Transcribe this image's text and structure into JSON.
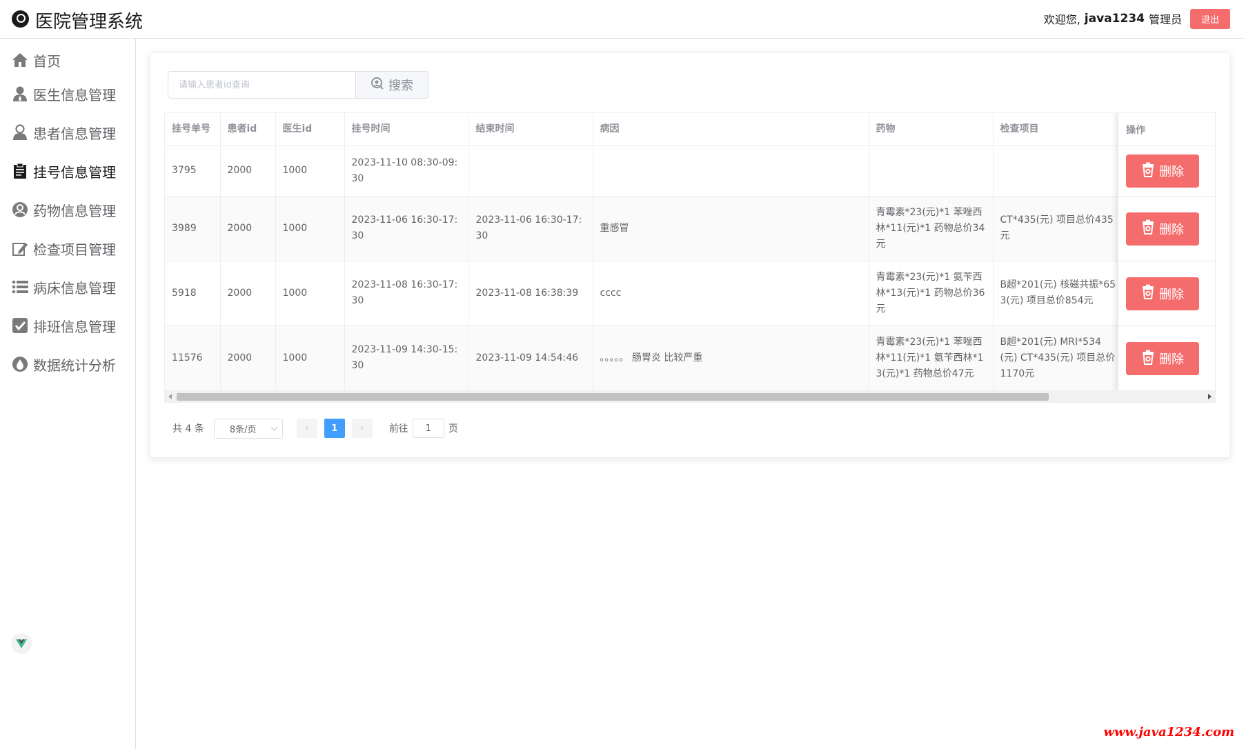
{
  "header": {
    "title": "医院管理系统",
    "welcome": "欢迎您,",
    "username": "java1234",
    "role": "管理员",
    "logout_label": "退出",
    "logo_icon": "hospital-logo-icon"
  },
  "sidebar": {
    "items": [
      {
        "label": "首页",
        "icon": "home-icon",
        "active": false
      },
      {
        "label": "医生信息管理",
        "icon": "doctor-icon",
        "active": false
      },
      {
        "label": "患者信息管理",
        "icon": "patient-icon",
        "active": false
      },
      {
        "label": "挂号信息管理",
        "icon": "clipboard-icon",
        "active": true
      },
      {
        "label": "药物信息管理",
        "icon": "medicine-icon",
        "active": false
      },
      {
        "label": "检查项目管理",
        "icon": "edit-icon",
        "active": false
      },
      {
        "label": "病床信息管理",
        "icon": "list-icon",
        "active": false
      },
      {
        "label": "排班信息管理",
        "icon": "checkbox-icon",
        "active": false
      },
      {
        "label": "数据统计分析",
        "icon": "chart-icon",
        "active": false
      }
    ],
    "footer_icon": "vue-icon"
  },
  "search": {
    "placeholder": "请输入患者id查询",
    "value": "",
    "button_label": "搜索"
  },
  "table": {
    "columns": [
      "挂号单号",
      "患者id",
      "医生id",
      "挂号时间",
      "结束时间",
      "病因",
      "药物",
      "检查项目",
      "操作"
    ],
    "rows": [
      {
        "id": "3795",
        "patient_id": "2000",
        "doctor_id": "1000",
        "reg_time": "2023-11-10 08:30-09:30",
        "end_time": "",
        "cause": "",
        "medicine": "",
        "exam": ""
      },
      {
        "id": "3989",
        "patient_id": "2000",
        "doctor_id": "1000",
        "reg_time": "2023-11-06 16:30-17:30",
        "end_time": "2023-11-06 16:30-17:30",
        "cause": "重感冒",
        "medicine": "青霉素*23(元)*1 苯唑西林*11(元)*1 药物总价34元",
        "exam": "CT*435(元) 项目总价435元"
      },
      {
        "id": "5918",
        "patient_id": "2000",
        "doctor_id": "1000",
        "reg_time": "2023-11-08 16:30-17:30",
        "end_time": "2023-11-08 16:38:39",
        "cause": "cccc",
        "medicine": "青霉素*23(元)*1 氨苄西林*13(元)*1 药物总价36元",
        "exam": "B超*201(元) 核磁共振*653(元) 项目总价854元"
      },
      {
        "id": "11576",
        "patient_id": "2000",
        "doctor_id": "1000",
        "reg_time": "2023-11-09 14:30-15:30",
        "end_time": "2023-11-09 14:54:46",
        "cause": "。。。。。 肠胃炎 比较严重",
        "medicine": "青霉素*23(元)*1 苯唑西林*11(元)*1 氨苄西林*13(元)*1 药物总价47元",
        "exam": "B超*201(元) MRI*534(元) CT*435(元) 项目总价1170元"
      }
    ],
    "delete_label": "删除"
  },
  "pagination": {
    "total": "共 4 条",
    "page_size": "8条/页",
    "current_page": "1",
    "goto_prefix": "前往",
    "goto_value": "1",
    "goto_suffix": "页"
  },
  "watermark": "www.java1234.com",
  "colors": {
    "danger": "#f56c6c",
    "primary": "#409eff"
  }
}
